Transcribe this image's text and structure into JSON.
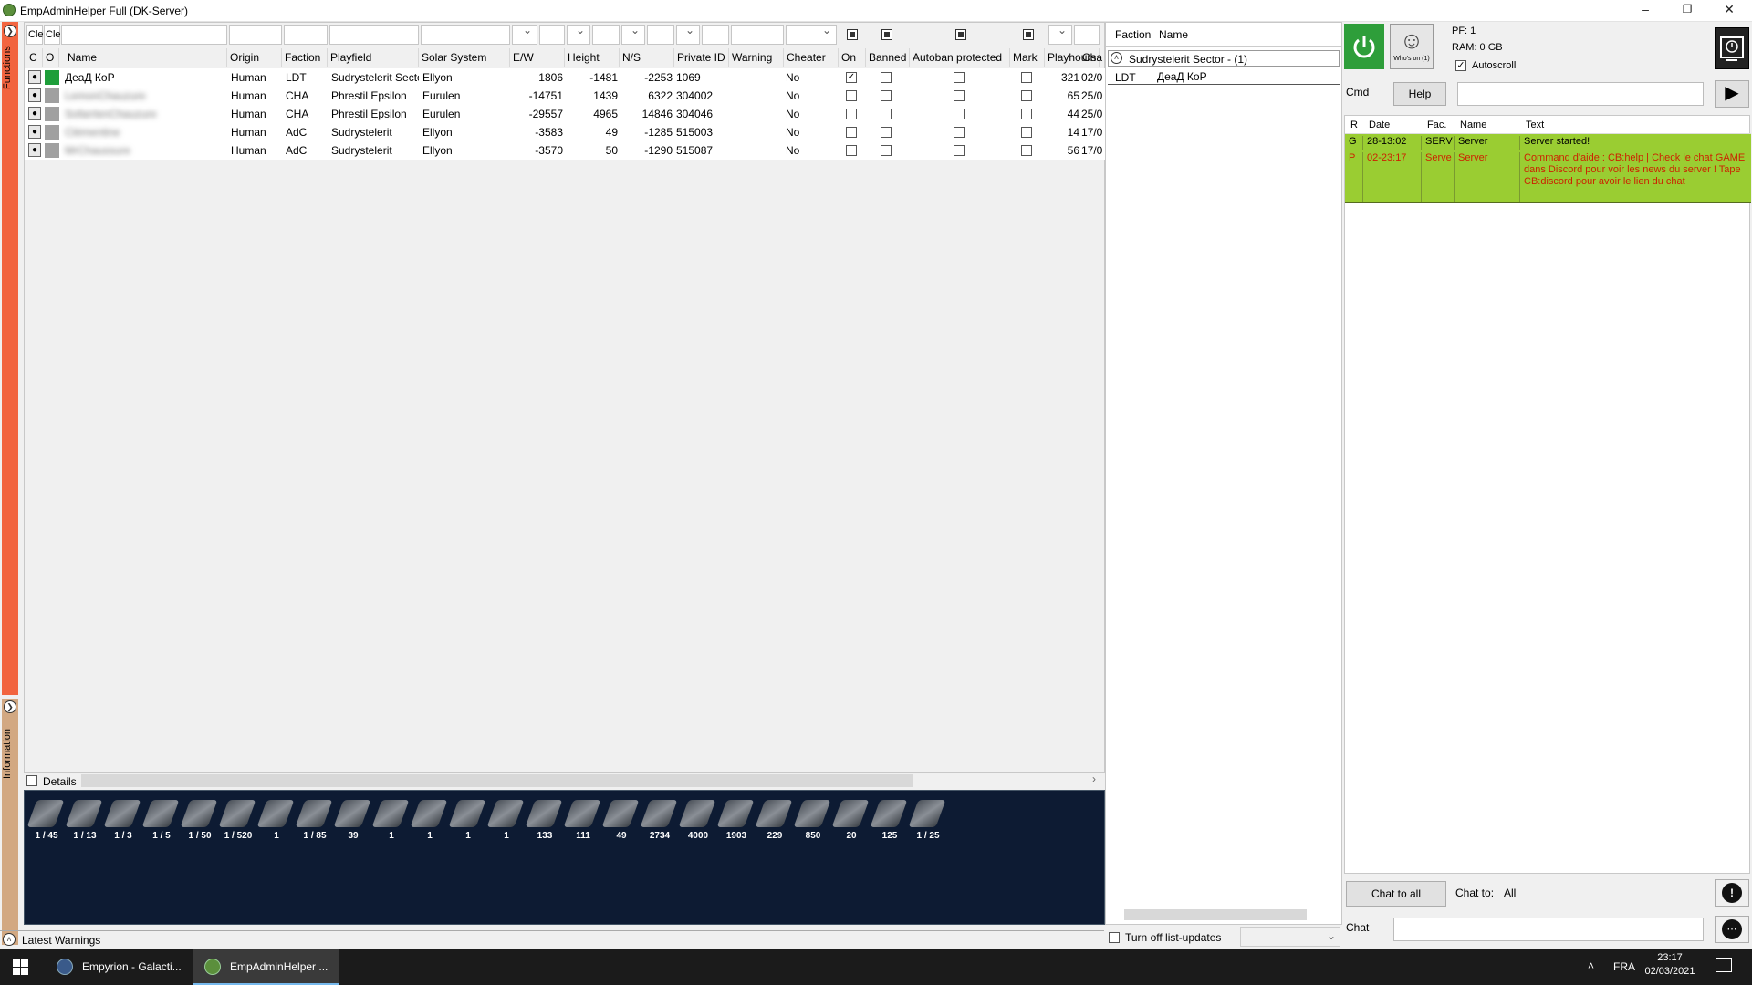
{
  "window": {
    "title": "EmpAdminHelper Full (DK-Server)"
  },
  "sidebar": {
    "functions_label": "Functions",
    "information_label": "Information"
  },
  "grid": {
    "filter_clear_1": "Cle",
    "filter_clear_2": "Cle",
    "columns": [
      "C",
      "O",
      "Name",
      "Origin",
      "Faction",
      "Playfield",
      "Solar System",
      "E/W",
      "Height",
      "N/S",
      "Private ID",
      "Warning",
      "Cheater",
      "On",
      "Banned",
      "Autoban protected",
      "Mark",
      "Playhours",
      "Cha"
    ],
    "rows": [
      {
        "name": "ДеаД КоР",
        "origin": "Human",
        "faction": "LDT",
        "playfield": "Sudrystelerit Secto",
        "system": "Ellyon",
        "ew": "1806",
        "height": "-1481",
        "ns": "-2253",
        "pid": "1069",
        "cheater": "No",
        "on": true,
        "playhours": "321",
        "cha": "02/0",
        "sq_color": "#1e9e3a"
      },
      {
        "name": "LemonChauzure",
        "origin": "Human",
        "faction": "CHA",
        "playfield": "Phrestil Epsilon",
        "system": "Eurulen",
        "ew": "-14751",
        "height": "1439",
        "ns": "6322",
        "pid": "304002",
        "cheater": "No",
        "on": false,
        "playhours": "65",
        "cha": "25/0",
        "sq_color": "#a0a0a0"
      },
      {
        "name": "SofarrlenChauzure",
        "origin": "Human",
        "faction": "CHA",
        "playfield": "Phrestil Epsilon",
        "system": "Eurulen",
        "ew": "-29557",
        "height": "4965",
        "ns": "14846",
        "pid": "304046",
        "cheater": "No",
        "on": false,
        "playhours": "44",
        "cha": "25/0",
        "sq_color": "#a0a0a0"
      },
      {
        "name": "Clémentine",
        "origin": "Human",
        "faction": "AdC",
        "playfield": "Sudrystelerit",
        "system": "Ellyon",
        "ew": "-3583",
        "height": "49",
        "ns": "-1285",
        "pid": "515003",
        "cheater": "No",
        "on": false,
        "playhours": "14",
        "cha": "17/0",
        "sq_color": "#a0a0a0"
      },
      {
        "name": "MrChaussure",
        "origin": "Human",
        "faction": "AdC",
        "playfield": "Sudrystelerit",
        "system": "Ellyon",
        "ew": "-3570",
        "height": "50",
        "ns": "-1290",
        "pid": "515087",
        "cheater": "No",
        "on": false,
        "playhours": "56",
        "cha": "17/0",
        "sq_color": "#a0a0a0"
      }
    ],
    "details_label": "Details"
  },
  "inventory": {
    "quantities": [
      "1 / 45",
      "1 / 13",
      "1 / 3",
      "1 / 5",
      "1 / 50",
      "1 / 520",
      "1",
      "1 / 85",
      "39",
      "1",
      "1",
      "1",
      "1",
      "133",
      "111",
      "49",
      "2734",
      "4000",
      "1903",
      "229",
      "850",
      "20",
      "125",
      "1 / 25"
    ]
  },
  "warnings": {
    "label": "Latest Warnings"
  },
  "players_panel": {
    "col_faction": "Faction",
    "col_name": "Name",
    "group": "Sudrystelerit Sector - (1)",
    "entries": [
      {
        "faction": "LDT",
        "name": "ДеаД КоР"
      }
    ],
    "turn_off_label": "Turn off list-updates"
  },
  "server": {
    "pf": "PF: 1",
    "ram": "RAM: 0 GB",
    "autoscroll": "Autoscroll",
    "whos_on": "Who's on (1)"
  },
  "cmd": {
    "label": "Cmd",
    "help": "Help",
    "value": ""
  },
  "log": {
    "columns": [
      "R",
      "Date",
      "Fac.",
      "Name",
      "Text"
    ],
    "rows": [
      {
        "r": "G",
        "date": "28-13:02",
        "fac": "SERV",
        "name": "Server",
        "text": "Server started!",
        "color": "#000000"
      },
      {
        "r": "P",
        "date": "02-23:17",
        "fac": "Serve",
        "name": "Server",
        "text": "Command d'aide : CB:help    |    Check le chat GAME dans Discord pour voir les news du server ! Tape CB:discord pour avoir le lien du chat",
        "color": "#cc2200"
      }
    ]
  },
  "chat": {
    "chat_to_all": "Chat to all",
    "chat_to_label": "Chat to:",
    "chat_to_value": "All",
    "chat_label": "Chat",
    "value": ""
  },
  "taskbar": {
    "apps": [
      "Empyrion - Galacti...",
      "EmpAdminHelper ..."
    ],
    "lang": "FRA",
    "time": "23:17",
    "date": "02/03/2021"
  }
}
